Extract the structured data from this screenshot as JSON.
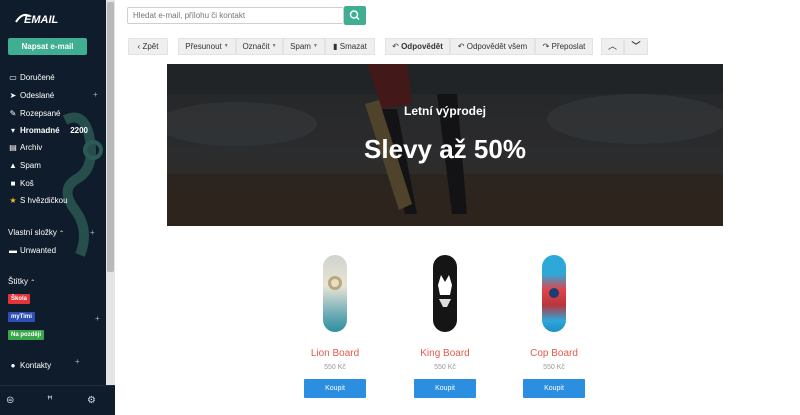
{
  "sidebar": {
    "logo": "EMAIL",
    "compose_label": "Napsat e-mail",
    "folders": [
      {
        "label": "Doručené",
        "icon": "inbox-icon",
        "count": ""
      },
      {
        "label": "Odeslané",
        "icon": "send-icon",
        "count": ""
      },
      {
        "label": "Rozepsané",
        "icon": "draft-icon",
        "count": ""
      },
      {
        "label": "Hromadné",
        "icon": "cart-icon",
        "count": "2200"
      },
      {
        "label": "Archiv",
        "icon": "archive-icon",
        "count": ""
      },
      {
        "label": "Spam",
        "icon": "warning-icon",
        "count": ""
      },
      {
        "label": "Koš",
        "icon": "trash-icon",
        "count": ""
      },
      {
        "label": "S hvězdičkou",
        "icon": "star-icon",
        "count": ""
      }
    ],
    "custom_folders_title": "Vlastní složky",
    "custom_folders": [
      {
        "label": "Unwanted"
      }
    ],
    "labels_title": "Štítky",
    "labels": [
      {
        "label": "Škola",
        "color": "#e3343a"
      },
      {
        "label": "myTimi",
        "color": "#2f4fb8"
      },
      {
        "label": "Na později",
        "color": "#3aa64a"
      }
    ],
    "contacts_label": "Kontakty"
  },
  "search": {
    "placeholder": "Hledat e-mail, přílohu či kontakt"
  },
  "toolbar": {
    "back": "Zpět",
    "move": "Přesunout",
    "mark": "Označit",
    "spam": "Spam",
    "delete": "Smazat",
    "reply": "Odpovědět",
    "reply_all": "Odpovědět všem",
    "forward": "Přeposlat"
  },
  "email": {
    "banner_subtitle": "Letní výprodej",
    "banner_title": "Slevy až 50%",
    "products": [
      {
        "name": "Lion Board",
        "price": "550 Kč",
        "buy": "Koupit"
      },
      {
        "name": "King Board",
        "price": "550 Kč",
        "buy": "Koupit"
      },
      {
        "name": "Cop Board",
        "price": "550 Kč",
        "buy": "Koupit"
      }
    ]
  },
  "colors": {
    "sidebar_bg": "#0f1c2b",
    "accent": "#3fae92",
    "buy_button": "#2b8ee0",
    "product_name": "#e35a4b"
  }
}
